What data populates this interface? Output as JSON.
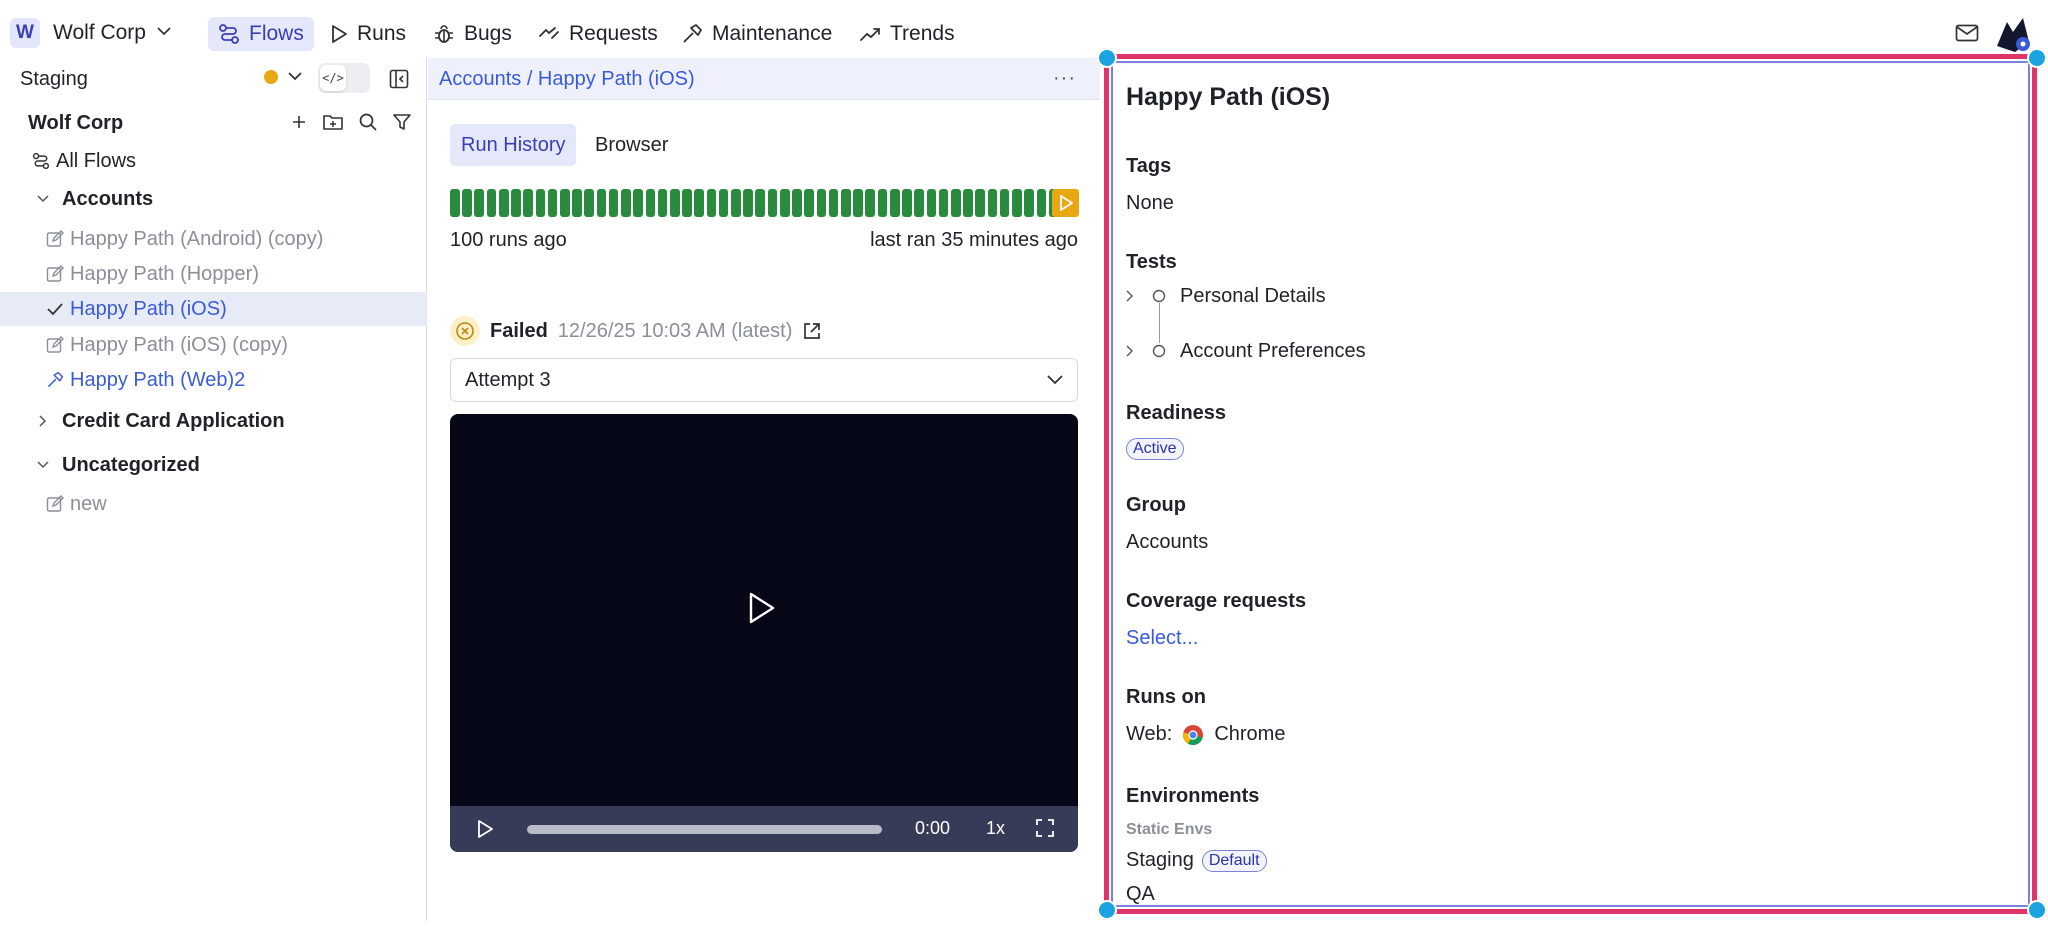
{
  "topbar": {
    "org_badge": "W",
    "org_name": "Wolf Corp",
    "nav": [
      {
        "label": "Flows",
        "icon": "flows-icon",
        "active": true
      },
      {
        "label": "Runs",
        "icon": "play-icon"
      },
      {
        "label": "Bugs",
        "icon": "bug-icon"
      },
      {
        "label": "Requests",
        "icon": "requests-icon"
      },
      {
        "label": "Maintenance",
        "icon": "hammer-icon"
      },
      {
        "label": "Trends",
        "icon": "trend-icon"
      }
    ]
  },
  "sidebar": {
    "environment": "Staging",
    "env_status_color": "#e8a814",
    "tree_title": "Wolf Corp",
    "all_flows": "All Flows",
    "groups": [
      {
        "name": "Accounts",
        "expanded": true
      },
      {
        "name": "Credit Card Application",
        "expanded": false
      },
      {
        "name": "Uncategorized",
        "expanded": true
      }
    ],
    "items": [
      {
        "label": "Happy Path (Android) (copy)",
        "state": "draft"
      },
      {
        "label": "Happy Path (Hopper)",
        "state": "draft"
      },
      {
        "label": "Happy Path (iOS)",
        "state": "selected"
      },
      {
        "label": "Happy Path (iOS) (copy)",
        "state": "draft"
      },
      {
        "label": "Happy Path (Web)2",
        "state": "maintenance"
      },
      {
        "label": "new",
        "state": "draft"
      }
    ]
  },
  "middle": {
    "breadcrumb": "Accounts / Happy Path (iOS)",
    "more": "···",
    "tabs": [
      "Run History",
      "Browser"
    ],
    "run_history": {
      "total_runs": 50,
      "passed_color": "#2a8a3e",
      "latest_color": "#e8a814"
    },
    "runs_ago": "100 runs ago",
    "last_ran": "last ran 35 minutes ago",
    "status_label": "Failed",
    "status_time": "12/26/25 10:03 AM (latest)",
    "attempt": "Attempt 3",
    "video": {
      "time": "0:00",
      "speed": "1x"
    }
  },
  "right": {
    "title": "Happy Path (iOS)",
    "tags_label": "Tags",
    "tags_value": "None",
    "tests_label": "Tests",
    "tests": [
      "Personal Details",
      "Account Preferences"
    ],
    "readiness_label": "Readiness",
    "readiness_value": "Active",
    "group_label": "Group",
    "group_value": "Accounts",
    "coverage_label": "Coverage requests",
    "coverage_value": "Select...",
    "runs_on_label": "Runs on",
    "runs_on_prefix": "Web:",
    "runs_on_value": "Chrome",
    "environments_label": "Environments",
    "static_envs_label": "Static Envs",
    "envs": [
      {
        "name": "Staging",
        "badge": "Default"
      },
      {
        "name": "QA",
        "badge": ""
      }
    ]
  }
}
